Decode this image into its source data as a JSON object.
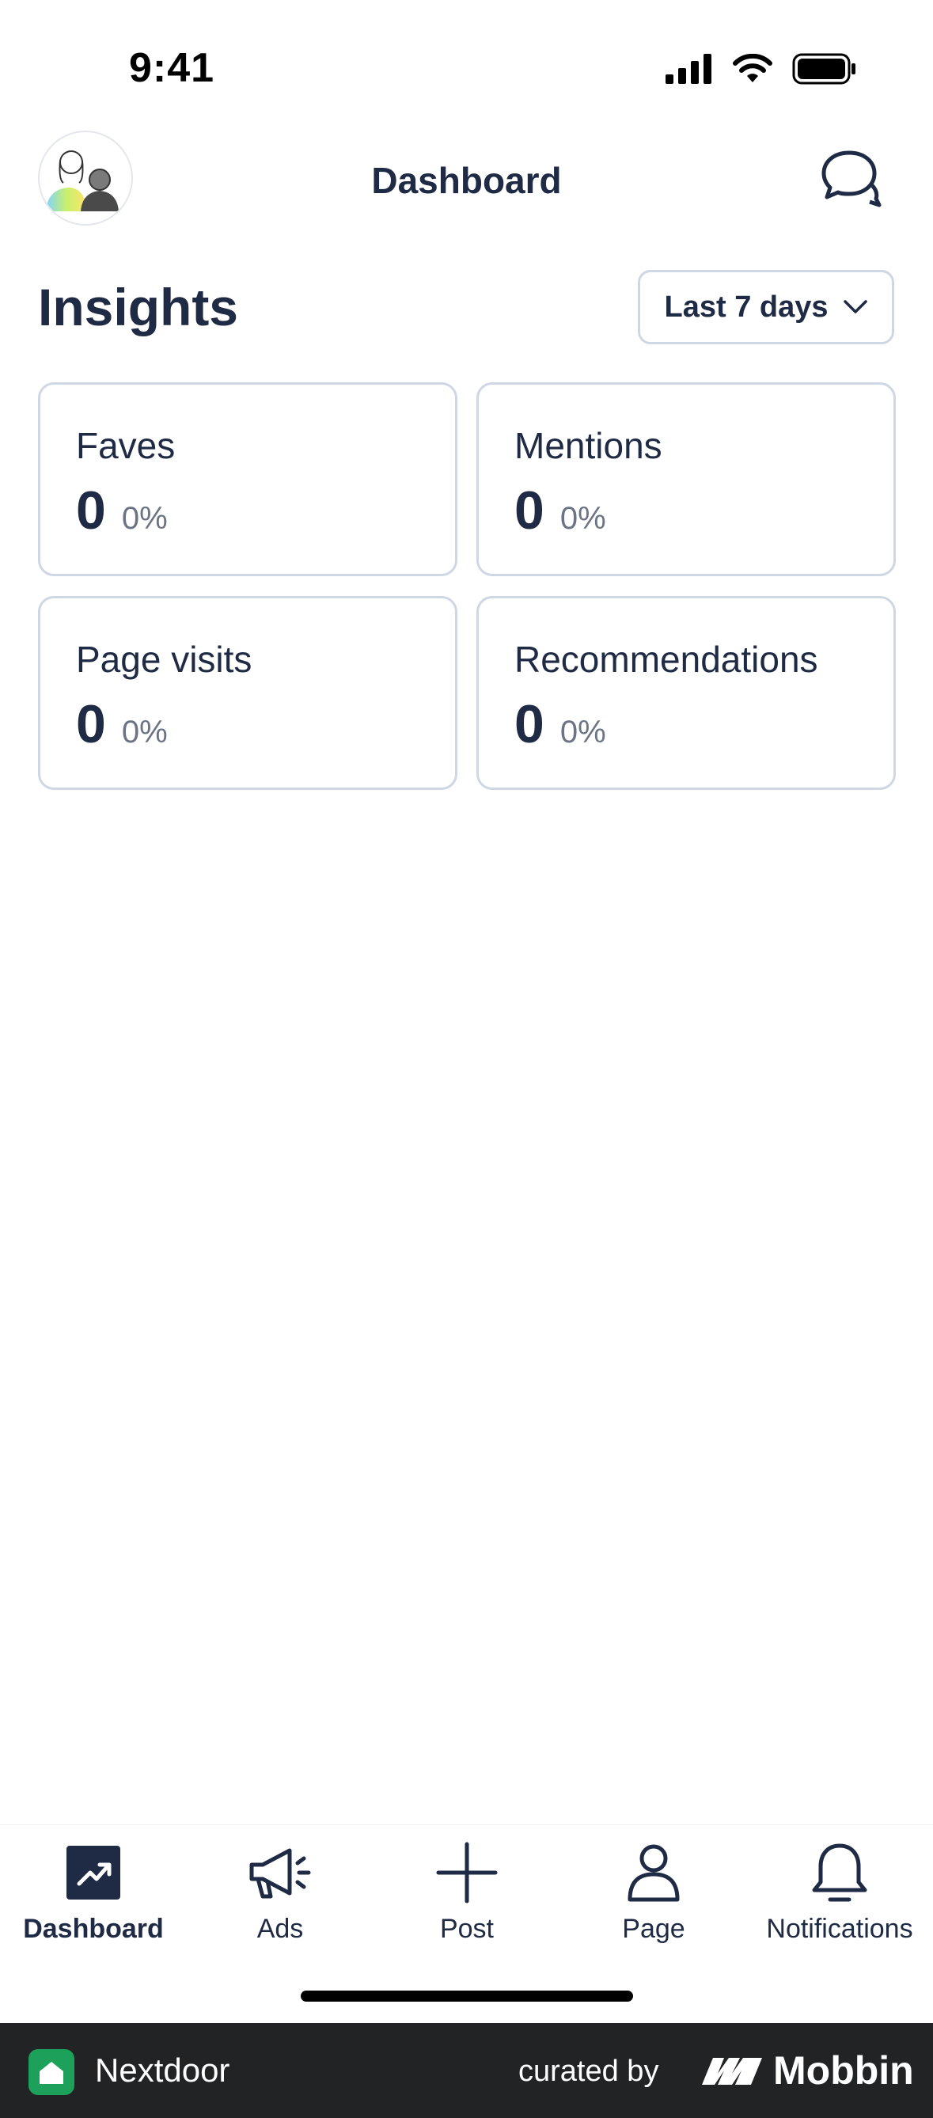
{
  "status_bar": {
    "time": "9:41"
  },
  "header": {
    "title": "Dashboard"
  },
  "insights": {
    "title": "Insights",
    "range": {
      "selected": "Last 7 days"
    },
    "cards": [
      {
        "label": "Faves",
        "value": "0",
        "change": "0%"
      },
      {
        "label": "Mentions",
        "value": "0",
        "change": "0%"
      },
      {
        "label": "Page visits",
        "value": "0",
        "change": "0%"
      },
      {
        "label": "Recommendations",
        "value": "0",
        "change": "0%"
      }
    ]
  },
  "tab_bar": {
    "tabs": [
      {
        "label": "Dashboard",
        "icon": "trending-up-icon",
        "active": true
      },
      {
        "label": "Ads",
        "icon": "megaphone-icon",
        "active": false
      },
      {
        "label": "Post",
        "icon": "plus-icon",
        "active": false
      },
      {
        "label": "Page",
        "icon": "person-icon",
        "active": false
      },
      {
        "label": "Notifications",
        "icon": "bell-icon",
        "active": false
      }
    ]
  },
  "footer": {
    "app_name": "Nextdoor",
    "curated_by": "curated by",
    "brand": "Mobbin"
  },
  "colors": {
    "text": "#1f2a44",
    "muted": "#6b7484",
    "border": "#cfd6e4",
    "footer_bg": "#222325",
    "nextdoor_green": "#1ca05a"
  }
}
